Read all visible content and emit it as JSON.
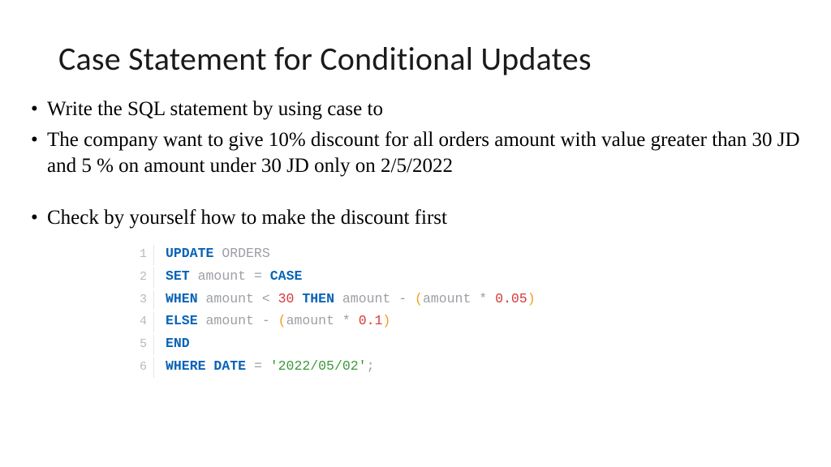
{
  "title": "Case Statement for Conditional Updates",
  "bullets": {
    "b1": "Write the SQL statement  by using case to",
    "b2": "The company want to give 10% discount for all orders amount with value greater than 30 JD  and 5 % on amount under 30 JD only on 2/5/2022",
    "b3": "Check by yourself how to make the discount first"
  },
  "code": {
    "l1": {
      "n": "1",
      "t": [
        {
          "c": "kw",
          "v": "UPDATE"
        },
        {
          "c": "",
          "v": " "
        },
        {
          "c": "id",
          "v": "ORDERS"
        }
      ]
    },
    "l2": {
      "n": "2",
      "t": [
        {
          "c": "kw",
          "v": "SET"
        },
        {
          "c": "",
          "v": " "
        },
        {
          "c": "id",
          "v": "amount"
        },
        {
          "c": "",
          "v": " "
        },
        {
          "c": "op",
          "v": "="
        },
        {
          "c": "",
          "v": " "
        },
        {
          "c": "kw",
          "v": "CASE"
        }
      ]
    },
    "l3": {
      "n": "3",
      "t": [
        {
          "c": "kw",
          "v": "WHEN"
        },
        {
          "c": "",
          "v": " "
        },
        {
          "c": "id",
          "v": "amount"
        },
        {
          "c": "",
          "v": " "
        },
        {
          "c": "op",
          "v": "<"
        },
        {
          "c": "",
          "v": " "
        },
        {
          "c": "num",
          "v": "30"
        },
        {
          "c": "",
          "v": " "
        },
        {
          "c": "kw",
          "v": "THEN"
        },
        {
          "c": "",
          "v": " "
        },
        {
          "c": "id",
          "v": "amount"
        },
        {
          "c": "",
          "v": " "
        },
        {
          "c": "op",
          "v": "-"
        },
        {
          "c": "",
          "v": " "
        },
        {
          "c": "par",
          "v": "("
        },
        {
          "c": "id",
          "v": "amount"
        },
        {
          "c": "",
          "v": " "
        },
        {
          "c": "op",
          "v": "*"
        },
        {
          "c": "",
          "v": " "
        },
        {
          "c": "num",
          "v": "0.05"
        },
        {
          "c": "par",
          "v": ")"
        }
      ]
    },
    "l4": {
      "n": "4",
      "t": [
        {
          "c": "kw",
          "v": "ELSE"
        },
        {
          "c": "",
          "v": " "
        },
        {
          "c": "id",
          "v": "amount"
        },
        {
          "c": "",
          "v": " "
        },
        {
          "c": "op",
          "v": "-"
        },
        {
          "c": "",
          "v": " "
        },
        {
          "c": "par",
          "v": "("
        },
        {
          "c": "id",
          "v": "amount"
        },
        {
          "c": "",
          "v": " "
        },
        {
          "c": "op",
          "v": "*"
        },
        {
          "c": "",
          "v": " "
        },
        {
          "c": "num",
          "v": "0.1"
        },
        {
          "c": "par",
          "v": ")"
        }
      ]
    },
    "l5": {
      "n": "5",
      "t": [
        {
          "c": "kw",
          "v": "END"
        }
      ]
    },
    "l6": {
      "n": "6",
      "t": [
        {
          "c": "kw",
          "v": "WHERE"
        },
        {
          "c": "",
          "v": " "
        },
        {
          "c": "kw",
          "v": "DATE"
        },
        {
          "c": "",
          "v": " "
        },
        {
          "c": "op",
          "v": "="
        },
        {
          "c": "",
          "v": " "
        },
        {
          "c": "str",
          "v": "'2022/05/02'"
        },
        {
          "c": "semi",
          "v": ";"
        }
      ]
    }
  }
}
